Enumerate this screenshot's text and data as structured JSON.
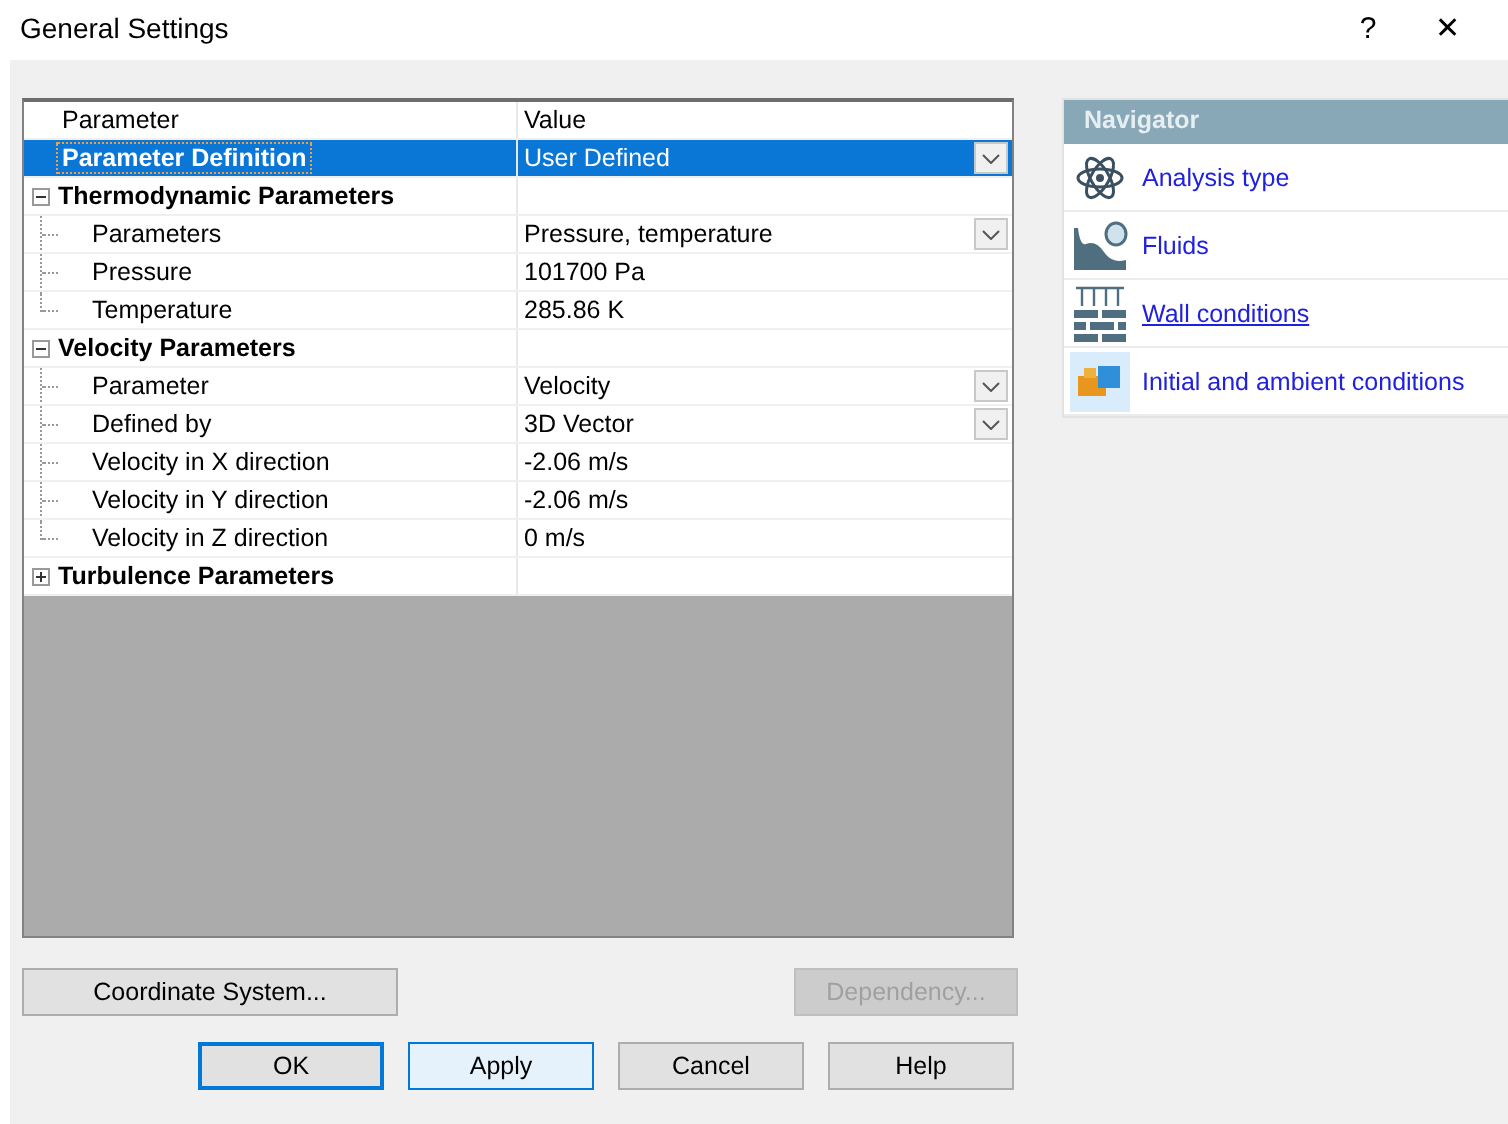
{
  "window": {
    "title": "General Settings",
    "help_glyph": "?",
    "close_glyph": "✕"
  },
  "grid": {
    "columns": [
      "Parameter",
      "Value"
    ],
    "rows": [
      {
        "kind": "property",
        "label": "Parameter Definition",
        "value": "User Defined",
        "dropdown": true,
        "selected": true
      },
      {
        "kind": "group",
        "label": "Thermodynamic Parameters",
        "expanded": true,
        "children": [
          {
            "label": "Parameters",
            "value": "Pressure, temperature",
            "dropdown": true,
            "selected": false
          },
          {
            "label": "Pressure",
            "value": "101700 Pa",
            "dropdown": false,
            "selected": false
          },
          {
            "label": "Temperature",
            "value": "285.86 K",
            "dropdown": false,
            "selected": false
          }
        ]
      },
      {
        "kind": "group",
        "label": "Velocity Parameters",
        "expanded": true,
        "children": [
          {
            "label": "Parameter",
            "value": "Velocity",
            "dropdown": true,
            "selected": false
          },
          {
            "label": "Defined by",
            "value": "3D Vector",
            "dropdown": true,
            "selected": false
          },
          {
            "label": "Velocity in X direction",
            "value": "-2.06 m/s",
            "dropdown": false,
            "selected": false
          },
          {
            "label": "Velocity in Y direction",
            "value": "-2.06 m/s",
            "dropdown": false,
            "selected": false
          },
          {
            "label": "Velocity in Z direction",
            "value": "0 m/s",
            "dropdown": false,
            "selected": false
          }
        ]
      },
      {
        "kind": "group",
        "label": "Turbulence Parameters",
        "expanded": false
      }
    ]
  },
  "navigator": {
    "title": "Navigator",
    "items": [
      {
        "kind": "atom",
        "label": "Analysis type",
        "underlined": false,
        "selected": false
      },
      {
        "kind": "fluid",
        "label": "Fluids",
        "underlined": false,
        "selected": false
      },
      {
        "kind": "wall",
        "label": "Wall conditions",
        "underlined": true,
        "selected": false
      },
      {
        "kind": "blocks",
        "label": "Initial and ambient conditions",
        "underlined": false,
        "selected": true
      }
    ]
  },
  "side_buttons": [
    {
      "label": "Coordinate System...",
      "disabled": false
    },
    {
      "label": "Dependency...",
      "disabled": true
    }
  ],
  "buttons": [
    {
      "label": "OK",
      "default": true,
      "hovered": false
    },
    {
      "label": "Apply",
      "default": false,
      "hovered": true
    },
    {
      "label": "Cancel",
      "default": false,
      "hovered": false
    },
    {
      "label": "Help",
      "default": false,
      "hovered": false
    }
  ]
}
